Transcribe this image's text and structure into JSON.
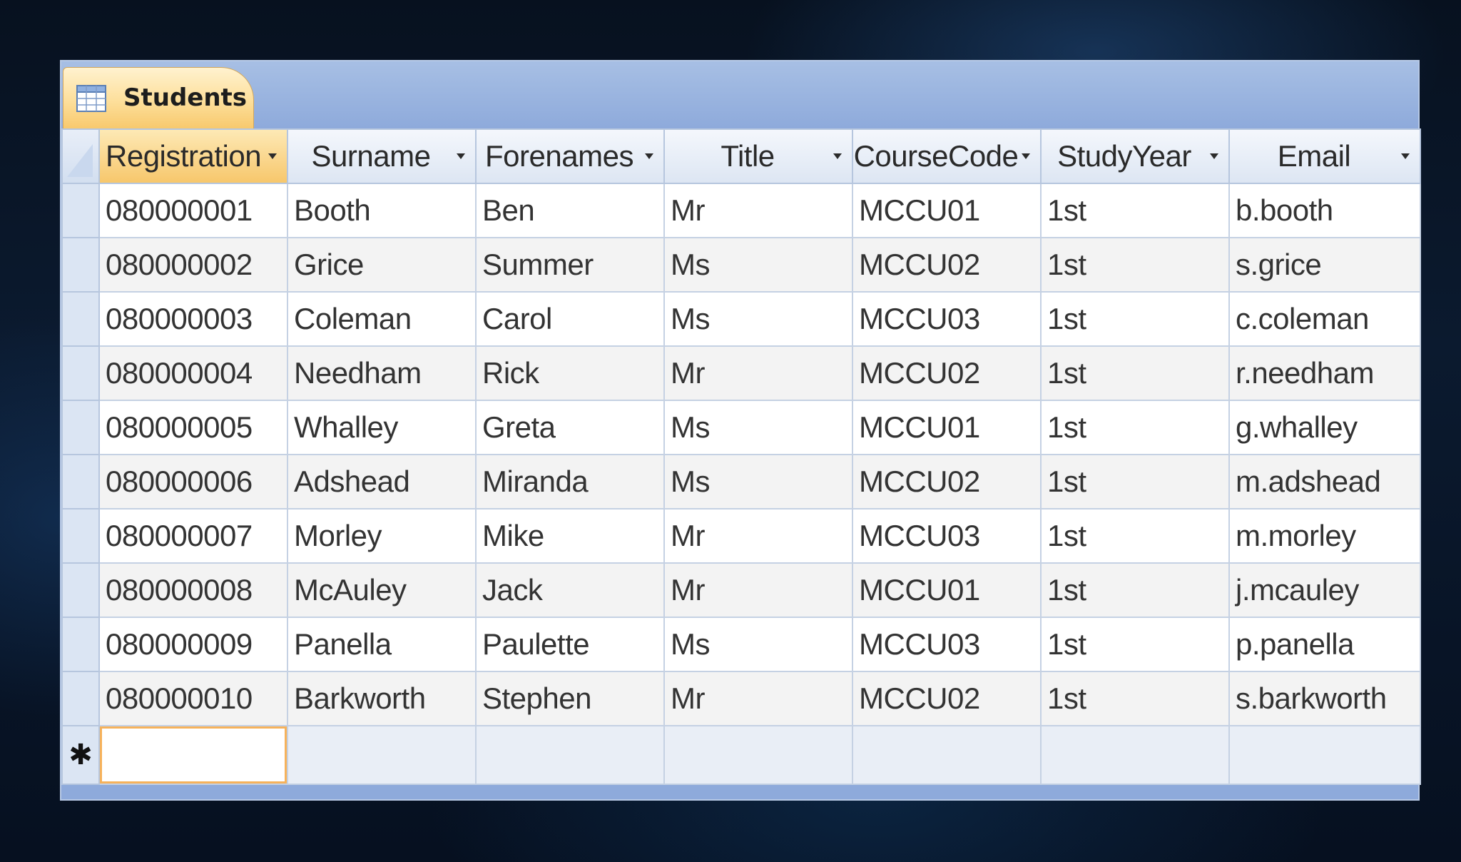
{
  "tab": {
    "label": "Students",
    "icon": "table-icon"
  },
  "columns": [
    {
      "label": "Registration"
    },
    {
      "label": "Surname"
    },
    {
      "label": "Forenames"
    },
    {
      "label": "Title"
    },
    {
      "label": "CourseCode"
    },
    {
      "label": "StudyYear"
    },
    {
      "label": "Email"
    }
  ],
  "rows": [
    {
      "registration": "080000001",
      "surname": "Booth",
      "forenames": "Ben",
      "title": "Mr",
      "coursecode": "MCCU01",
      "studyyear": "1st",
      "email": "b.booth"
    },
    {
      "registration": "080000002",
      "surname": "Grice",
      "forenames": "Summer",
      "title": "Ms",
      "coursecode": "MCCU02",
      "studyyear": "1st",
      "email": "s.grice"
    },
    {
      "registration": "080000003",
      "surname": "Coleman",
      "forenames": "Carol",
      "title": "Ms",
      "coursecode": "MCCU03",
      "studyyear": "1st",
      "email": "c.coleman"
    },
    {
      "registration": "080000004",
      "surname": "Needham",
      "forenames": "Rick",
      "title": "Mr",
      "coursecode": "MCCU02",
      "studyyear": "1st",
      "email": "r.needham"
    },
    {
      "registration": "080000005",
      "surname": "Whalley",
      "forenames": "Greta",
      "title": "Ms",
      "coursecode": "MCCU01",
      "studyyear": "1st",
      "email": "g.whalley"
    },
    {
      "registration": "080000006",
      "surname": "Adshead",
      "forenames": "Miranda",
      "title": "Ms",
      "coursecode": "MCCU02",
      "studyyear": "1st",
      "email": "m.adshead"
    },
    {
      "registration": "080000007",
      "surname": "Morley",
      "forenames": "Mike",
      "title": "Mr",
      "coursecode": "MCCU03",
      "studyyear": "1st",
      "email": "m.morley"
    },
    {
      "registration": "080000008",
      "surname": "McAuley",
      "forenames": "Jack",
      "title": "Mr",
      "coursecode": "MCCU01",
      "studyyear": "1st",
      "email": "j.mcauley"
    },
    {
      "registration": "080000009",
      "surname": "Panella",
      "forenames": "Paulette",
      "title": "Ms",
      "coursecode": "MCCU03",
      "studyyear": "1st",
      "email": "p.panella"
    },
    {
      "registration": "080000010",
      "surname": "Barkworth",
      "forenames": "Stephen",
      "title": "Mr",
      "coursecode": "MCCU02",
      "studyyear": "1st",
      "email": "s.barkworth"
    }
  ],
  "new_record_marker": "✱",
  "colors": {
    "active_header": "#f7c76c",
    "tab_background": "#fddf9b",
    "window_frame": "#8eaadb",
    "focus_border": "#f6b25b"
  }
}
